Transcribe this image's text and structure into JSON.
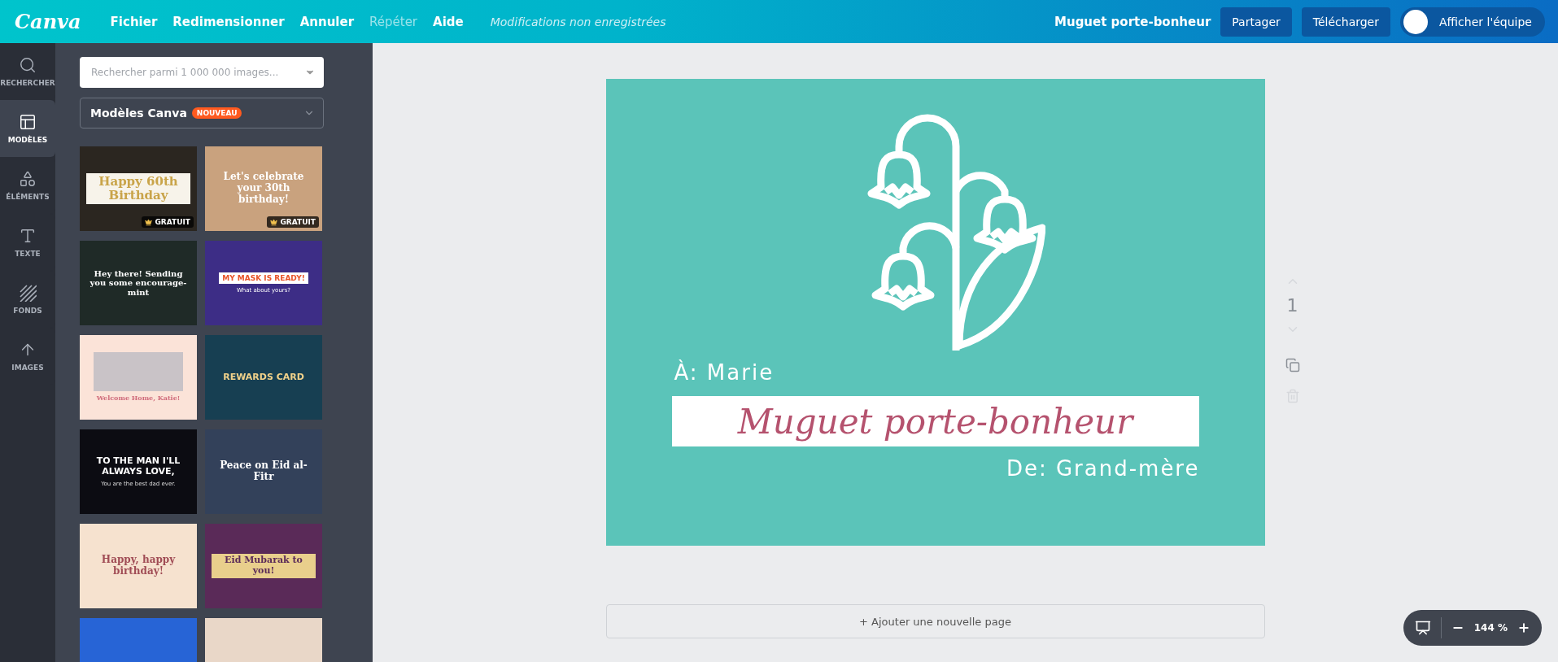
{
  "topbar": {
    "logo": "Canva",
    "menu": [
      {
        "label": "Fichier",
        "disabled": false
      },
      {
        "label": "Redimensionner",
        "disabled": false
      },
      {
        "label": "Annuler",
        "disabled": false
      },
      {
        "label": "Répéter",
        "disabled": true
      },
      {
        "label": "Aide",
        "disabled": false
      }
    ],
    "status": "Modifications non enregistrées",
    "doc_title": "Muguet porte-bonheur",
    "buttons": [
      "Partager",
      "Télécharger"
    ],
    "team_button": "Afficher l'équipe"
  },
  "rail": [
    {
      "label": "RECHERCHER",
      "kind": "search",
      "selected": false
    },
    {
      "label": "MODÈLES",
      "kind": "layout",
      "selected": true
    },
    {
      "label": "ÉLÉMENTS",
      "kind": "shapes",
      "selected": false
    },
    {
      "label": "TEXTE",
      "kind": "text",
      "selected": false
    },
    {
      "label": "FONDS",
      "kind": "hatch",
      "selected": false
    },
    {
      "label": "IMAGES",
      "kind": "upload",
      "selected": false
    }
  ],
  "panel": {
    "search": {
      "placeholder": "Rechercher parmi 1 000 000 images..."
    },
    "category": {
      "label": "Modèles Canva",
      "badge": "NOUVEAU"
    },
    "templates": [
      {
        "kind": "gold",
        "color": "#2b2620",
        "title": "Happy 60th Birthday",
        "badge": "GRATUIT"
      },
      {
        "kind": "tan",
        "color": "#c9a27e",
        "title": "Let's celebrate your 30th birthday!",
        "badge": "GRATUIT"
      },
      {
        "kind": "script",
        "color": "#1f2a27",
        "title": "Hey there! Sending you some encourage-mint"
      },
      {
        "kind": "banner",
        "color": "#3d2d86",
        "title": "MY MASK IS READY!",
        "subtitle": "What about yours?"
      },
      {
        "kind": "photo",
        "color": "#fbe3d8",
        "title": "Welcome Home, Katie!"
      },
      {
        "kind": "rewards",
        "color": "#173f52",
        "title": "REWARDS CARD"
      },
      {
        "kind": "bold",
        "color": "#0c0c12",
        "title": "TO THE MAN I'LL ALWAYS LOVE,",
        "subtitle": "You are the best dad ever."
      },
      {
        "kind": "eid",
        "color": "#33415a",
        "title": "Peace on Eid al-Fitr"
      },
      {
        "kind": "floral",
        "color": "#f6e2cf",
        "title": "Happy, happy birthday!"
      },
      {
        "kind": "mubarak",
        "color": "#5a2a58",
        "title": "Eid Mubarak to you!"
      },
      {
        "kind": "plain",
        "color": "#2764d6"
      },
      {
        "kind": "plain",
        "color": "#e9d7c8"
      }
    ]
  },
  "design": {
    "to": "À: Marie",
    "title": "Muguet porte-bonheur",
    "from": "De: Grand-mère"
  },
  "page_controls": {
    "page_number": "1"
  },
  "add_page": "+ Ajouter une nouvelle page",
  "zoom": {
    "value": "144 %"
  }
}
